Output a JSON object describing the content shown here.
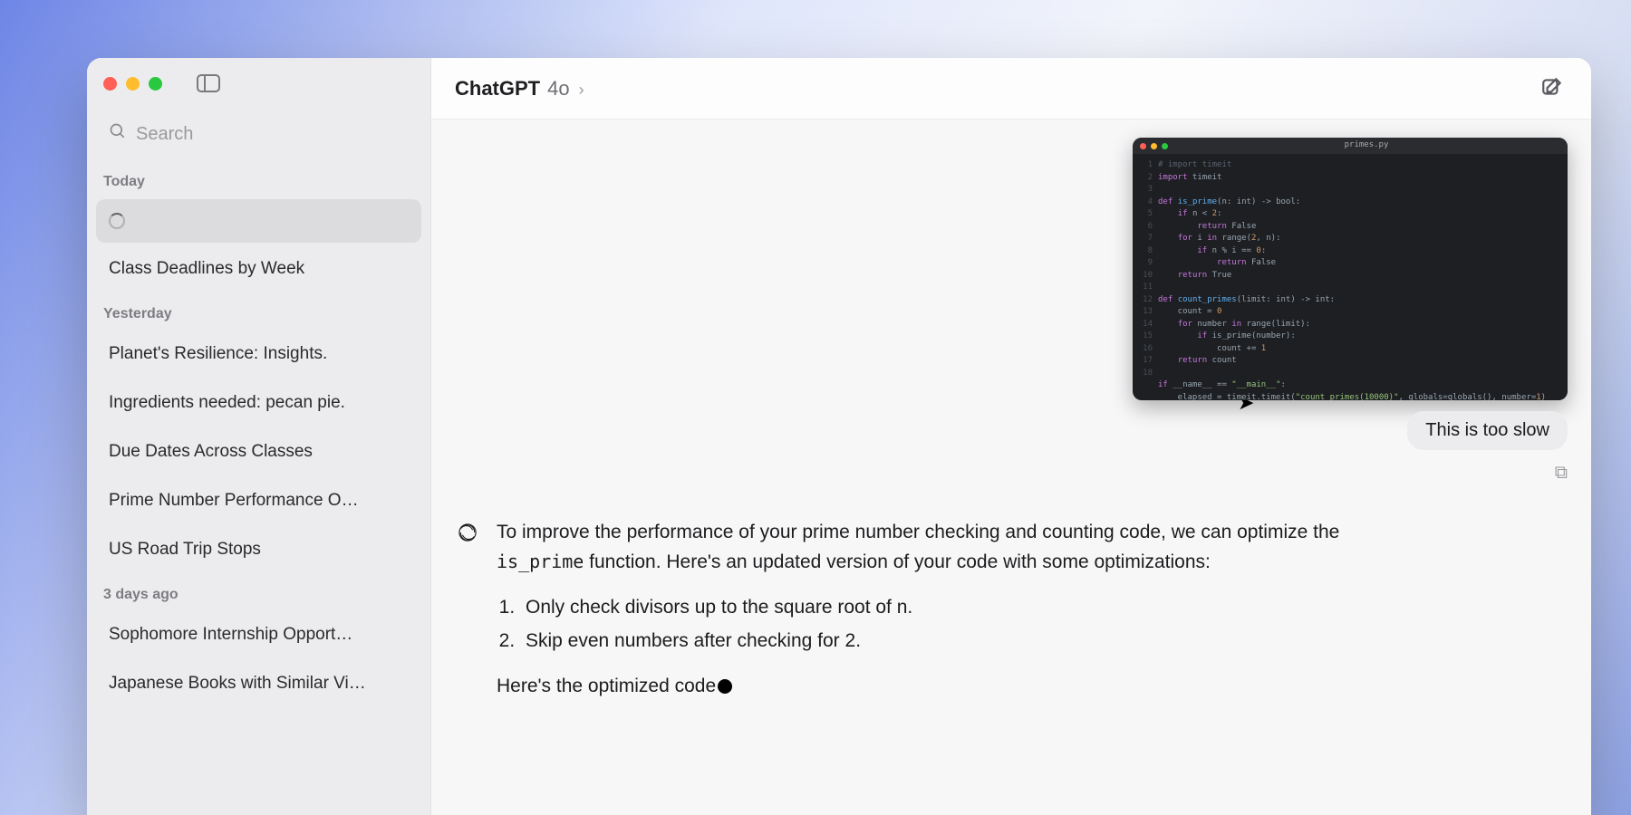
{
  "header": {
    "brand": "ChatGPT",
    "model": "4o",
    "chevron": "›"
  },
  "search": {
    "placeholder": "Search"
  },
  "sidebar": {
    "sections": [
      {
        "label": "Today",
        "items": [
          {
            "title": "",
            "loading": true
          },
          {
            "title": "Class Deadlines by Week"
          }
        ]
      },
      {
        "label": "Yesterday",
        "items": [
          {
            "title": "Planet's Resilience: Insights."
          },
          {
            "title": "Ingredients needed: pecan pie."
          },
          {
            "title": "Due Dates Across Classes"
          },
          {
            "title": "Prime Number Performance O…"
          },
          {
            "title": "US Road Trip Stops"
          }
        ]
      },
      {
        "label": "3 days ago",
        "items": [
          {
            "title": "Sophomore Internship Opport…"
          },
          {
            "title": "Japanese Books with Similar Vi…"
          }
        ]
      }
    ]
  },
  "chat": {
    "user_message": "This is too slow",
    "code_thumb_title": "primes.py",
    "assistant": {
      "para1_a": "To improve the performance of your prime number checking and counting code, we can optimize the ",
      "para1_code": "is_prime",
      "para1_b": " function. Here's an updated version of your code with some optimizations:",
      "bullets": [
        "Only check divisors up to the square root of n.",
        "Skip even numbers after checking for 2."
      ],
      "para2": "Here's the optimized code"
    }
  }
}
